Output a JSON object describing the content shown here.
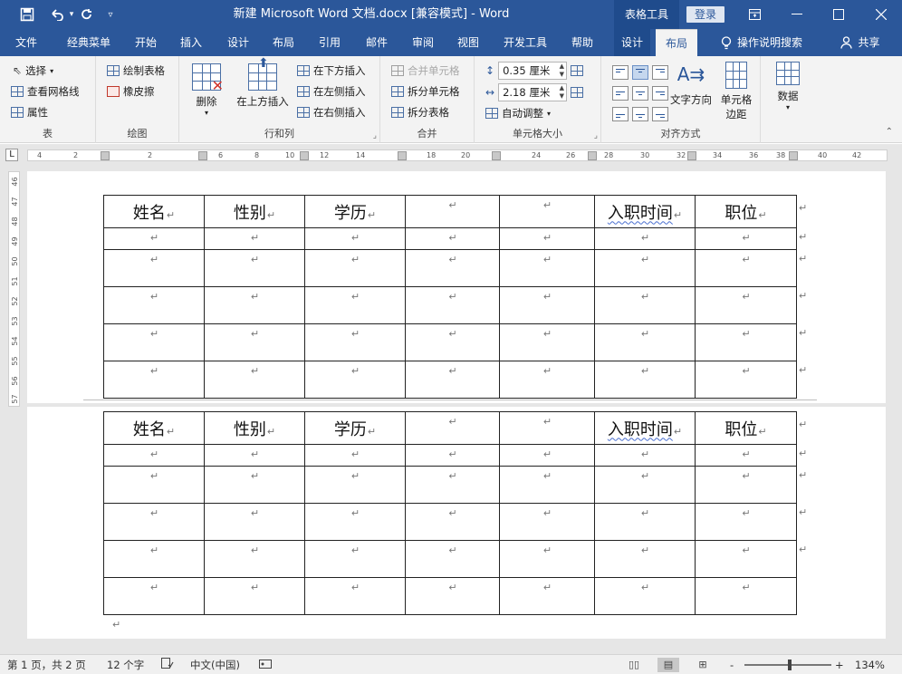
{
  "titlebar": {
    "document_title": "新建 Microsoft Word 文档.docx [兼容模式]  -  Word",
    "context_tools": "表格工具",
    "login_label": "登录",
    "icons": [
      "save-icon",
      "undo-icon",
      "redo-icon",
      "customize-qat-icon",
      "ribbon-display-icon",
      "minimize-icon",
      "maximize-icon",
      "close-icon"
    ]
  },
  "tabs": [
    {
      "label": "文件"
    },
    {
      "label": "经典菜单"
    },
    {
      "label": "开始"
    },
    {
      "label": "插入"
    },
    {
      "label": "设计"
    },
    {
      "label": "布局"
    },
    {
      "label": "引用"
    },
    {
      "label": "邮件"
    },
    {
      "label": "审阅"
    },
    {
      "label": "视图"
    },
    {
      "label": "开发工具"
    },
    {
      "label": "帮助"
    },
    {
      "label": "设计"
    },
    {
      "label": "布局"
    }
  ],
  "tell_me": "操作说明搜索",
  "share": "共享",
  "ribbon": {
    "table_group": {
      "label": "表",
      "select": "选择",
      "view_gridlines": "查看网格线",
      "properties": "属性"
    },
    "draw_group": {
      "label": "绘图",
      "draw_table": "绘制表格",
      "eraser": "橡皮擦"
    },
    "rows_cols_group": {
      "label": "行和列",
      "delete": "删除",
      "insert_above": "在上方插入",
      "insert_below": "在下方插入",
      "insert_left": "在左侧插入",
      "insert_right": "在右侧插入"
    },
    "merge_group": {
      "label": "合并",
      "merge_cells": "合并单元格",
      "split_cells": "拆分单元格",
      "split_table": "拆分表格"
    },
    "cell_size_group": {
      "label": "单元格大小",
      "height_value": "0.35 厘米",
      "width_value": "2.18 厘米",
      "autofit": "自动调整"
    },
    "alignment_group": {
      "label": "对齐方式",
      "text_direction": "文字方向",
      "cell_margins_line1": "单元格",
      "cell_margins_line2": "边距"
    },
    "data_group": {
      "label": "数据"
    }
  },
  "ruler": {
    "h_numbers": [
      "4",
      "2",
      "2",
      "6",
      "8",
      "10",
      "12",
      "14",
      "18",
      "20",
      "24",
      "26",
      "28",
      "30",
      "32",
      "34",
      "36",
      "38",
      "40",
      "42"
    ],
    "v_numbers": [
      "46",
      "47",
      "48",
      "49",
      "50",
      "51",
      "52",
      "53",
      "54",
      "55",
      "56",
      "57"
    ]
  },
  "tables": [
    {
      "headers": [
        "姓名",
        "性别",
        "学历",
        "",
        "",
        "入职时间",
        "职位"
      ],
      "empty_rows": 5
    },
    {
      "headers": [
        "姓名",
        "性别",
        "学历",
        "",
        "",
        "入职时间",
        "职位"
      ],
      "empty_rows": 5
    }
  ],
  "paragraph_mark": "↵",
  "status": {
    "page": "第 1 页，共 2 页",
    "words": "12 个字",
    "language": "中文(中国)",
    "zoom_minus": "-",
    "zoom_plus": "+",
    "zoom": "134%"
  }
}
